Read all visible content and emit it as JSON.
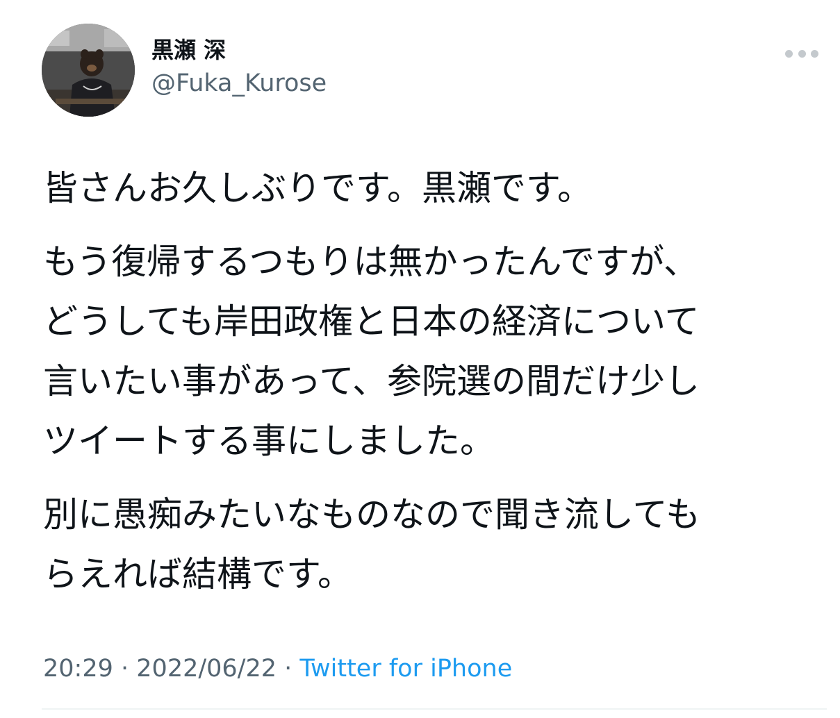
{
  "tweet": {
    "author": {
      "display_name": "黒瀬 深",
      "handle": "@Fuka_Kurose"
    },
    "more_icon": "more-horizontal-icon",
    "paragraphs": [
      [
        "皆さんお久しぶりです。黒瀬です。"
      ],
      [
        "もう復帰するつもりは無かったんですが、",
        "どうしても岸田政権と日本の経済について",
        "言いたい事があって、参院選の間だけ少し",
        "ツイートする事にしました。"
      ],
      [
        "別に愚痴みたいなものなので聞き流しても",
        "らえれば結構です。"
      ]
    ],
    "meta": {
      "time": "20:29",
      "separator": "·",
      "date": "2022/06/22",
      "source": "Twitter for iPhone"
    }
  },
  "colors": {
    "text": "#0f1419",
    "secondary": "#536471",
    "link": "#1d9bf0",
    "divider": "#eff3f4"
  }
}
